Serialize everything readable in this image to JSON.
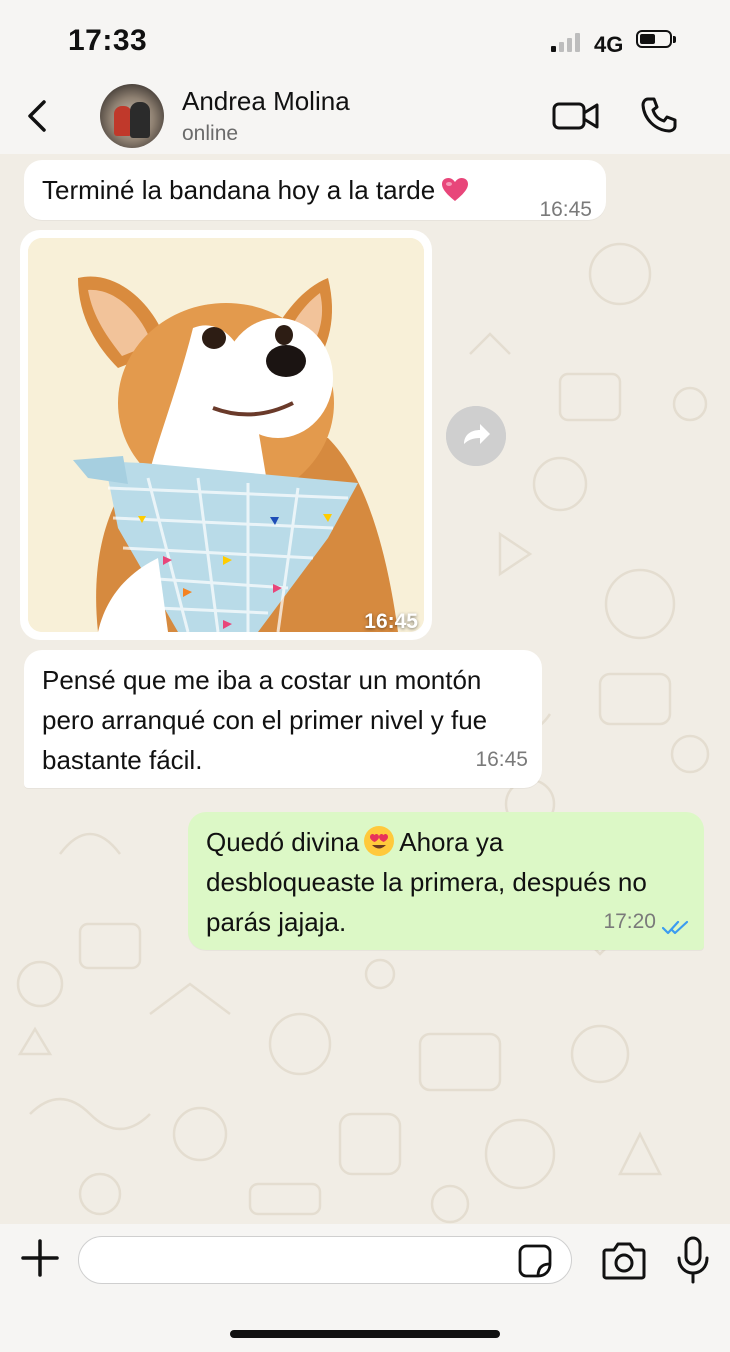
{
  "status_bar": {
    "time": "17:33",
    "network": "4G"
  },
  "header": {
    "contact_name": "Andrea Molina",
    "contact_status": "online"
  },
  "messages": [
    {
      "direction": "in",
      "text": "Terminé la bandana hoy a la tarde",
      "emoji": "heart-emoji",
      "time": "16:45"
    },
    {
      "direction": "in",
      "type": "image",
      "image_description": "corgi wearing a checkered bandana",
      "time": "16:45"
    },
    {
      "direction": "in",
      "lines": [
        "Pensé que me iba a costar un montón",
        "pero arranqué con el primer nivel y fue",
        "bastante fácil."
      ],
      "time": "16:45"
    },
    {
      "direction": "out",
      "line1_a": "Quedó divina",
      "line1_b": "Ahora ya",
      "line2": "desbloqueaste la primera, después no",
      "line3": "parás jajaja.",
      "emoji": "heart-eyes-emoji",
      "time": "17:20",
      "read_status": "double-check-blue"
    }
  ],
  "input": {
    "placeholder": ""
  },
  "colors": {
    "outgoing_bubble": "#dcf8c6",
    "incoming_bubble": "#ffffff",
    "read_tick": "#3b9cf0"
  }
}
